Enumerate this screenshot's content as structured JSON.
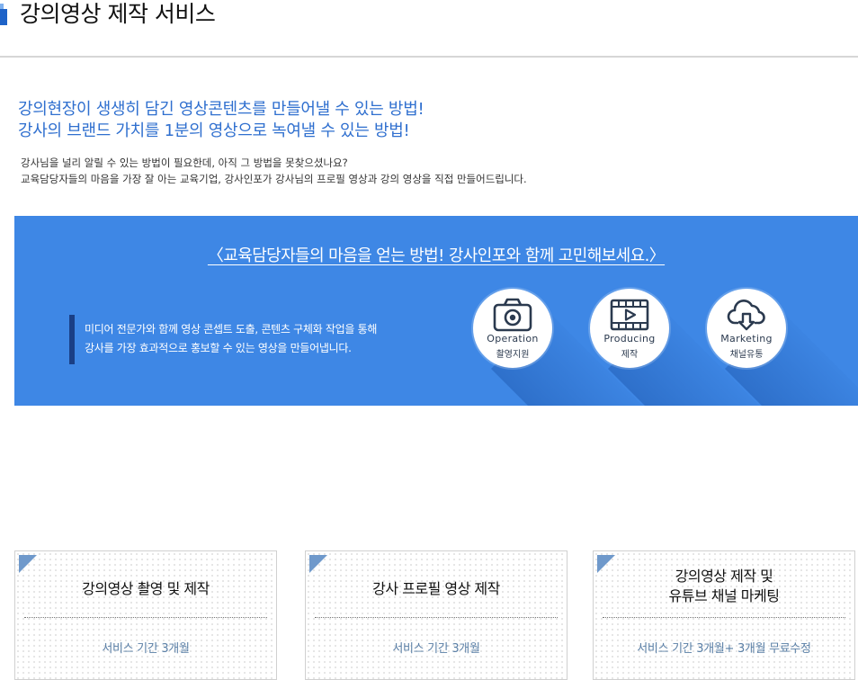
{
  "header": {
    "title": "강의영상 제작 서비스"
  },
  "headline": {
    "line1": "강의현장이 생생히 담긴 영상콘텐츠를 만들어낼 수 있는 방법!",
    "line2": "강사의 브랜드 가치를 1분의 영상으로 녹여낼 수 있는 방법!"
  },
  "intro": {
    "line1": "강사님을 널리 알릴 수 있는 방법이 필요한데, 아직 그 방법을 못찾으셨나요?",
    "line2": "교육담당자들의 마음을 가장 잘 아는 교육기업, 강사인포가 강사님의 프로필 영상과 강의 영상을 직접 만들어드립니다."
  },
  "banner": {
    "title": "〈교육담당자들의 마음을 얻는 방법! 강사인포와 함께 고민해보세요.〉",
    "text_line1": "미디어 전문가와 함께 영상 콘셉트 도출, 콘텐츠 구체화 작업을 통해",
    "text_line2": "강사를 가장 효과적으로 홍보할 수 있는 영상을 만들어냅니다.",
    "services": [
      {
        "en": "Operation",
        "ko": "촬영지원",
        "icon": "camera-icon"
      },
      {
        "en": "Producing",
        "ko": "제작",
        "icon": "film-play-icon"
      },
      {
        "en": "Marketing",
        "ko": "채널유통",
        "icon": "cloud-download-icon"
      }
    ]
  },
  "cards": [
    {
      "title_line1": "강의영상 촬영 및 제작",
      "title_line2": "",
      "meta": "서비스 기간 3개월"
    },
    {
      "title_line1": "강사 프로필 영상 제작",
      "title_line2": "",
      "meta": "서비스 기간 3개월"
    },
    {
      "title_line1": "강의영상 제작 및",
      "title_line2": "유튜브 채널 마케팅",
      "meta": "서비스 기간 3개월+ 3개월 무료수정"
    }
  ],
  "colors": {
    "accent": "#2f6fcf",
    "banner": "#3e87e5",
    "banner_bar": "#1a3f86",
    "card_corner": "#6f99cb"
  }
}
